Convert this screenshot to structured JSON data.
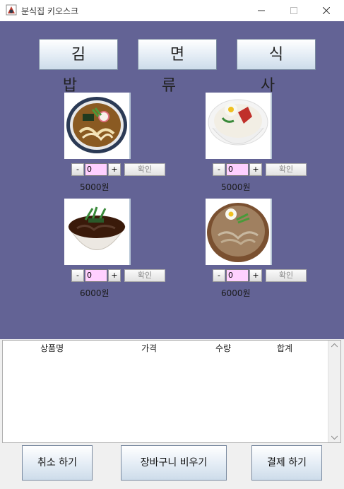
{
  "window": {
    "title": "분식집 키오스크",
    "icon": "kiosk-app-icon"
  },
  "categories": [
    {
      "label": "김밥"
    },
    {
      "label": "면류"
    },
    {
      "label": "식사"
    }
  ],
  "menu_items": [
    {
      "image": "udon-bowl-photo",
      "qty": "0",
      "price": "5000원",
      "minus": "-",
      "plus": "+",
      "confirm": "확인"
    },
    {
      "image": "spicy-naengmyeon-photo",
      "qty": "0",
      "price": "5000원",
      "minus": "-",
      "plus": "+",
      "confirm": "확인"
    },
    {
      "image": "soba-bowl-photo",
      "qty": "0",
      "price": "6000원",
      "minus": "-",
      "plus": "+",
      "confirm": "확인"
    },
    {
      "image": "mul-naengmyeon-photo",
      "qty": "0",
      "price": "6000원",
      "minus": "-",
      "plus": "+",
      "confirm": "확인"
    }
  ],
  "cart": {
    "headers": [
      "상품명",
      "가격",
      "수량",
      "합계"
    ],
    "rows": []
  },
  "actions": {
    "cancel": "취소 하기",
    "clear_cart": "장바구니 비우기",
    "pay": "결제 하기"
  },
  "colors": {
    "menu_panel_bg": "#636395",
    "qty_field_bg": "#ffd0ff"
  }
}
